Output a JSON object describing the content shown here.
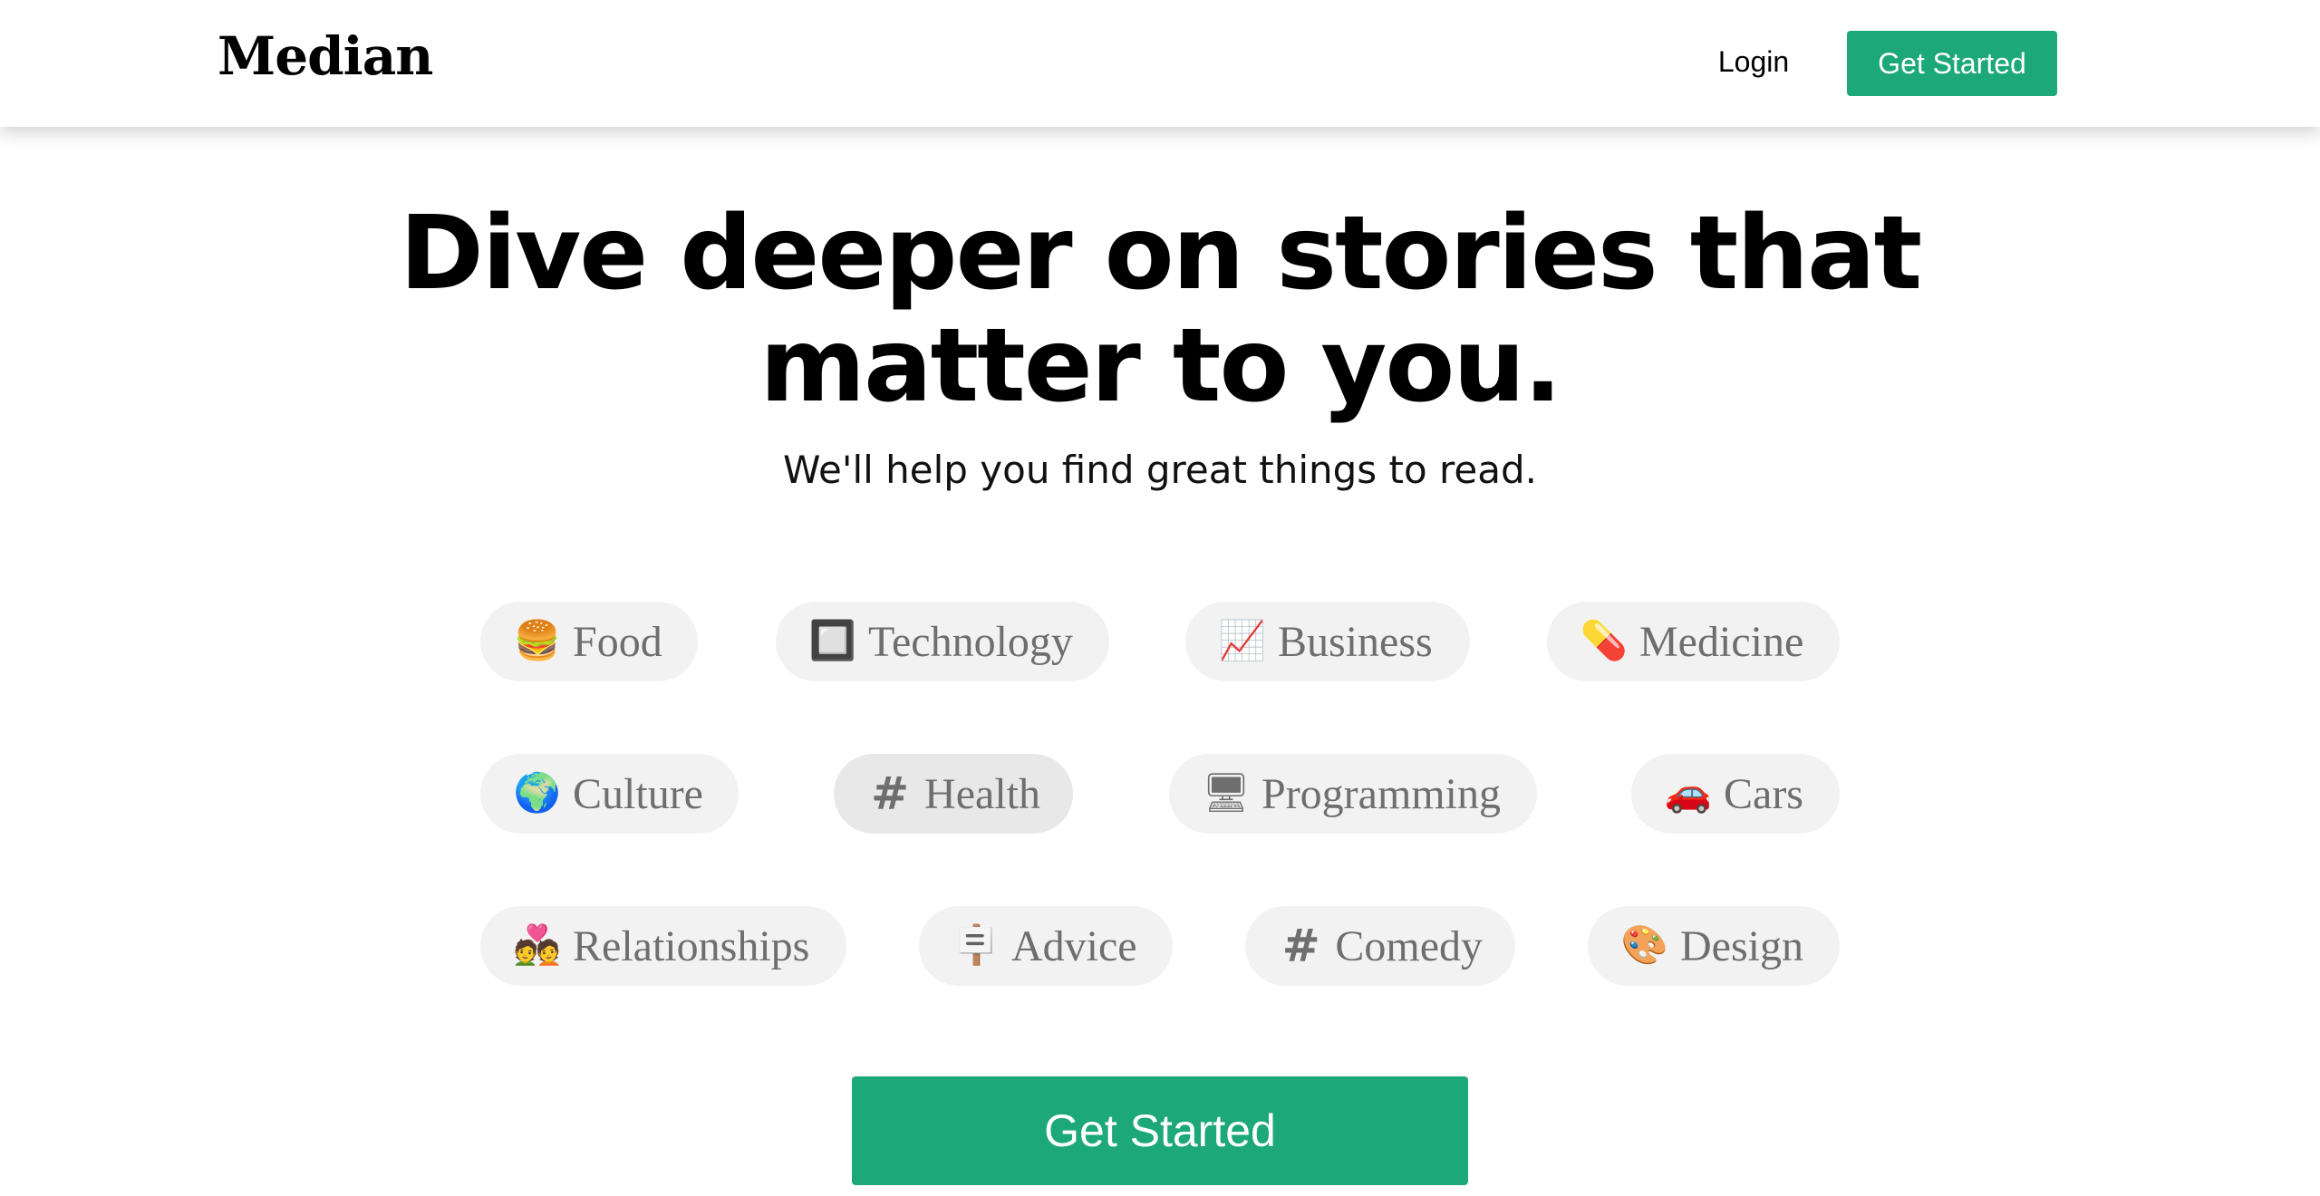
{
  "header": {
    "logo": "Median",
    "login_label": "Login",
    "cta_label": "Get Started"
  },
  "hero": {
    "title_line1": "Dive deeper on stories that",
    "title_line2": "matter to you.",
    "subtitle": "We'll help you find great things to read."
  },
  "topics": [
    {
      "label": "Food",
      "icon": "hamburger-icon",
      "glyph": "🍔"
    },
    {
      "label": "Technology",
      "icon": "microchip-icon",
      "glyph": "🔲"
    },
    {
      "label": "Business",
      "icon": "chart-increasing-icon",
      "glyph": "📈"
    },
    {
      "label": "Medicine",
      "icon": "pill-icon",
      "glyph": "💊"
    },
    {
      "label": "Culture",
      "icon": "globe-icon",
      "glyph": "🌍"
    },
    {
      "label": "Health",
      "icon": "hashtag-icon",
      "glyph": "#"
    },
    {
      "label": "Programming",
      "icon": "code-window-icon",
      "glyph": "🖥"
    },
    {
      "label": "Cars",
      "icon": "car-icon",
      "glyph": "🚗"
    },
    {
      "label": "Relationships",
      "icon": "couple-icon",
      "glyph": "💑"
    },
    {
      "label": "Advice",
      "icon": "signpost-icon",
      "glyph": "🪧"
    },
    {
      "label": "Comedy",
      "icon": "hashtag-icon",
      "glyph": "#"
    },
    {
      "label": "Design",
      "icon": "palette-icon",
      "glyph": "🎨"
    }
  ],
  "main_cta_label": "Get Started",
  "colors": {
    "accent": "#1da87a",
    "chip_bg": "#f2f2f2",
    "chip_text": "#6e6e6e"
  }
}
